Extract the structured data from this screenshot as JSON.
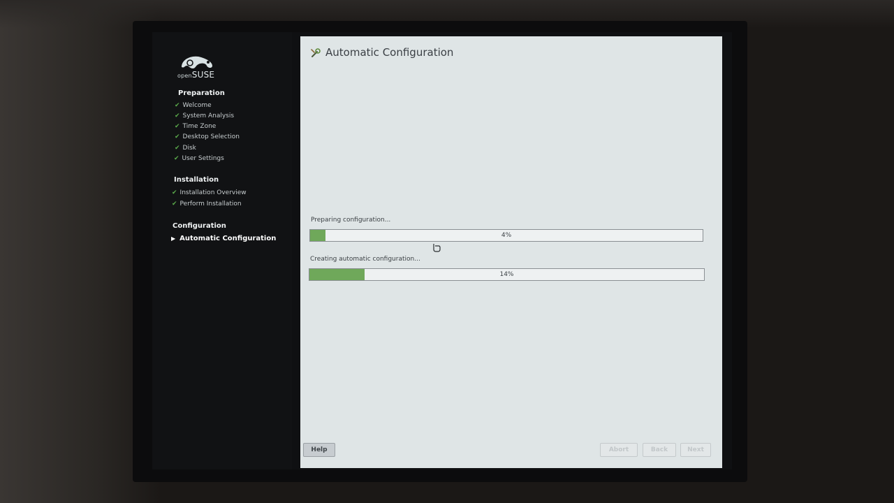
{
  "brand": {
    "logo_small": "open",
    "logo_large": "SUSE"
  },
  "sidebar": {
    "sections": [
      {
        "title": "Preparation",
        "steps": [
          {
            "label": "Welcome",
            "state": "done"
          },
          {
            "label": "System Analysis",
            "state": "done"
          },
          {
            "label": "Time Zone",
            "state": "done"
          },
          {
            "label": "Desktop Selection",
            "state": "done"
          },
          {
            "label": "Disk",
            "state": "done"
          },
          {
            "label": "User Settings",
            "state": "done"
          }
        ]
      },
      {
        "title": "Installation",
        "steps": [
          {
            "label": "Installation Overview",
            "state": "done"
          },
          {
            "label": "Perform Installation",
            "state": "done"
          }
        ]
      },
      {
        "title": "Configuration",
        "steps": [
          {
            "label": "Automatic Configuration",
            "state": "current"
          }
        ]
      }
    ]
  },
  "main": {
    "title": "Automatic Configuration",
    "progress": [
      {
        "label": "Preparing configuration...",
        "text": "4%",
        "value": 0.04
      },
      {
        "label": "Creating automatic configuration...",
        "text": "14%",
        "value": 0.14
      }
    ]
  },
  "buttons": {
    "help": "Help",
    "abort": "Abort",
    "back": "Back",
    "next": "Next"
  },
  "colors": {
    "progress_fill": "#6fa85a",
    "check": "#5aa94a",
    "content_bg": "#dfe5e6",
    "sidebar_bg": "#111214"
  },
  "icons": {
    "title": "config-wrench-icon",
    "step_done": "check-icon",
    "step_current": "arrow-right-icon"
  }
}
